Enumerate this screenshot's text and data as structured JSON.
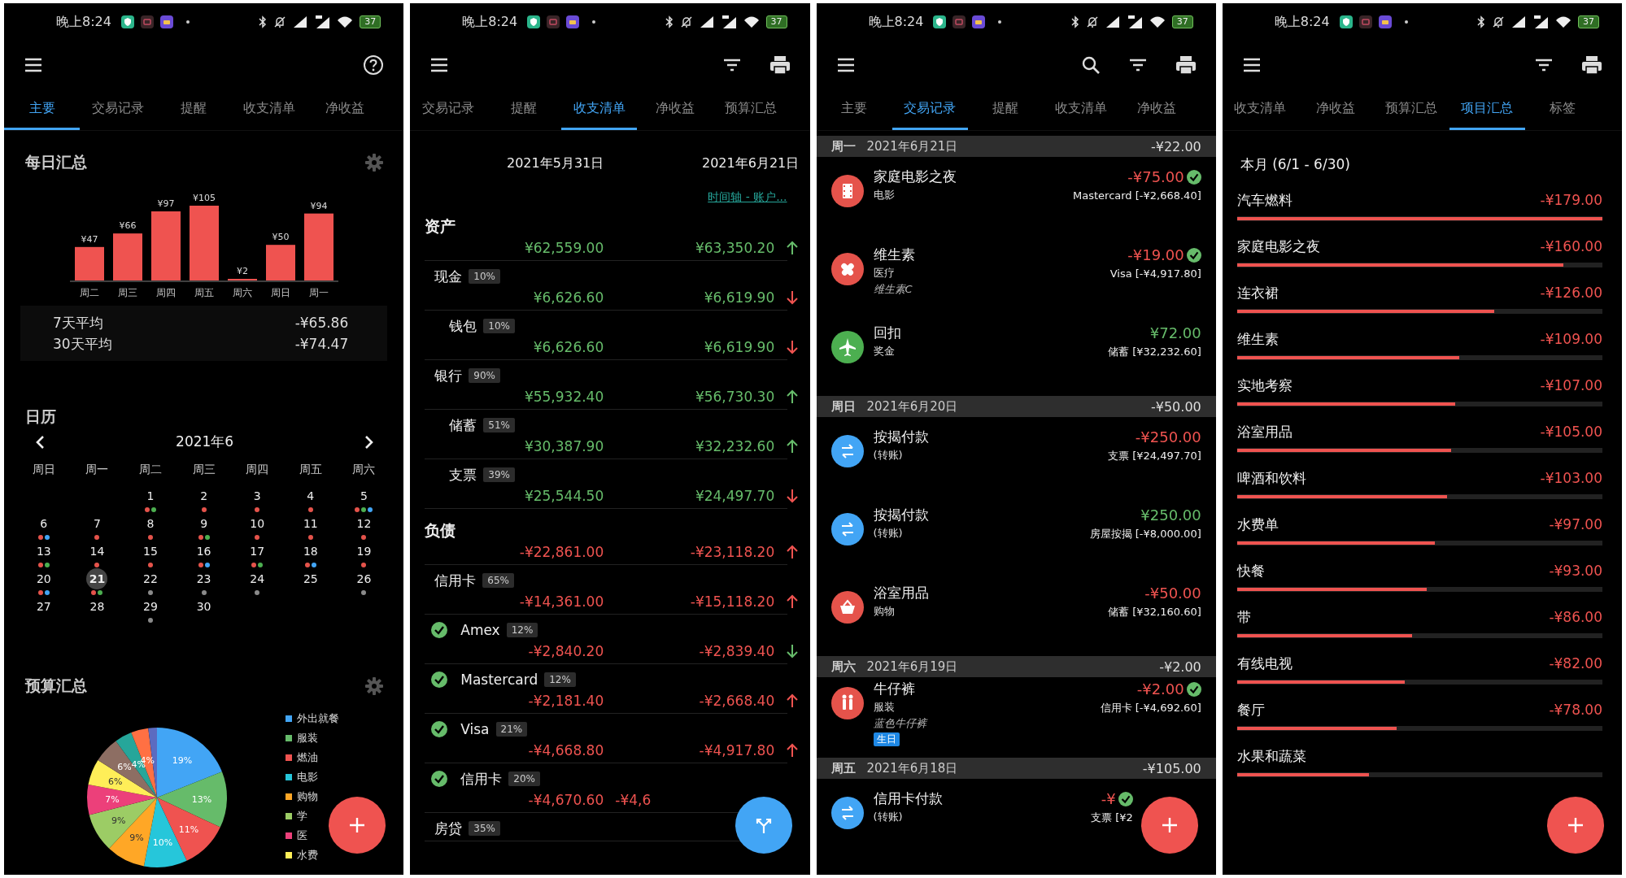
{
  "screens": [
    {
      "kind": "summary",
      "status": {
        "time": "晚上8:24",
        "battery": "37"
      },
      "actions": [
        {
          "kind": "help"
        }
      ],
      "tabs": [
        {
          "label": "主要",
          "selected": true
        },
        {
          "label": "交易记录",
          "selected": false
        },
        {
          "label": "提醒",
          "selected": false
        },
        {
          "label": "收支清单",
          "selected": false
        },
        {
          "label": "净收益",
          "selected": false
        }
      ],
      "daily": {
        "title": "每日汇总",
        "chart_data": {
          "type": "bar",
          "categories": [
            "周二",
            "周三",
            "周四",
            "周五",
            "周六",
            "周日",
            "周一"
          ],
          "values": [
            47,
            66,
            97,
            105,
            2,
            50,
            94
          ],
          "value_labels": [
            "¥47",
            "¥66",
            "¥97",
            "¥105",
            "¥2",
            "¥50",
            "¥94"
          ]
        },
        "averages": [
          {
            "label": "7天平均",
            "value": "-¥65.86"
          },
          {
            "label": "30天平均",
            "value": "-¥74.47"
          }
        ]
      },
      "calendar": {
        "title": "日历",
        "month": "2021年6",
        "weekdays": [
          "周日",
          "周一",
          "周二",
          "周三",
          "周四",
          "周五",
          "周六"
        ],
        "weeks": [
          [
            {
              "day": "1",
              "selected": false,
              "dots": [
                {
                  "color": "#e5534b"
                },
                {
                  "color": "#4caf50"
                }
              ]
            },
            {
              "day": "2",
              "selected": false,
              "dots": [
                {
                  "color": "#e5534b"
                }
              ]
            },
            {
              "day": "3",
              "selected": false,
              "dots": [
                {
                  "color": "#e5534b"
                }
              ]
            },
            {
              "day": "4",
              "selected": false,
              "dots": [
                {
                  "color": "#e5534b"
                }
              ]
            },
            {
              "day": "5",
              "selected": false,
              "dots": [
                {
                  "color": "#e5534b"
                },
                {
                  "color": "#4caf50"
                },
                {
                  "color": "#42a5f5"
                }
              ]
            }
          ],
          [
            {
              "day": "6",
              "selected": false,
              "dots": [
                {
                  "color": "#e5534b"
                },
                {
                  "color": "#42a5f5"
                }
              ]
            },
            {
              "day": "7",
              "selected": false,
              "dots": [
                {
                  "color": "#e5534b"
                }
              ]
            },
            {
              "day": "8",
              "selected": false,
              "dots": [
                {
                  "color": "#e5534b"
                }
              ]
            },
            {
              "day": "9",
              "selected": false,
              "dots": [
                {
                  "color": "#e5534b"
                },
                {
                  "color": "#4caf50"
                }
              ]
            },
            {
              "day": "10",
              "selected": false,
              "dots": [
                {
                  "color": "#e5534b"
                }
              ]
            },
            {
              "day": "11",
              "selected": false,
              "dots": [
                {
                  "color": "#e5534b"
                }
              ]
            },
            {
              "day": "12",
              "selected": false,
              "dots": [
                {
                  "color": "#e5534b"
                }
              ]
            }
          ],
          [
            {
              "day": "13",
              "selected": false,
              "dots": [
                {
                  "color": "#e5534b"
                },
                {
                  "color": "#4caf50"
                }
              ]
            },
            {
              "day": "14",
              "selected": false,
              "dots": [
                {
                  "color": "#e5534b"
                }
              ]
            },
            {
              "day": "15",
              "selected": false,
              "dots": [
                {
                  "color": "#e5534b"
                }
              ]
            },
            {
              "day": "16",
              "selected": false,
              "dots": [
                {
                  "color": "#e5534b"
                },
                {
                  "color": "#42a5f5"
                }
              ]
            },
            {
              "day": "17",
              "selected": false,
              "dots": [
                {
                  "color": "#e5534b"
                },
                {
                  "color": "#4caf50"
                }
              ]
            },
            {
              "day": "18",
              "selected": false,
              "dots": [
                {
                  "color": "#e5534b"
                },
                {
                  "color": "#42a5f5"
                }
              ]
            },
            {
              "day": "19",
              "selected": false,
              "dots": [
                {
                  "color": "#e5534b"
                }
              ]
            }
          ],
          [
            {
              "day": "20",
              "selected": false,
              "dots": [
                {
                  "color": "#e5534b"
                },
                {
                  "color": "#42a5f5"
                }
              ]
            },
            {
              "day": "21",
              "selected": true,
              "dots": [
                {
                  "color": "#e5534b"
                },
                {
                  "color": "#4caf50"
                }
              ]
            },
            {
              "day": "22",
              "selected": false,
              "dots": [
                {
                  "color": "#8a8a8a"
                }
              ]
            },
            {
              "day": "23",
              "selected": false,
              "dots": [
                {
                  "color": "#8a8a8a"
                }
              ]
            },
            {
              "day": "24",
              "selected": false,
              "dots": [
                {
                  "color": "#8a8a8a"
                }
              ]
            },
            {
              "day": "25",
              "selected": false
            },
            {
              "day": "26",
              "selected": false,
              "dots": [
                {
                  "color": "#8a8a8a"
                }
              ]
            }
          ],
          [
            {
              "day": "27",
              "selected": false
            },
            {
              "day": "28",
              "selected": false
            },
            {
              "day": "29",
              "selected": false,
              "dots": [
                {
                  "color": "#8a8a8a"
                }
              ]
            },
            {
              "day": "30",
              "selected": false
            }
          ]
        ]
      },
      "budget": {
        "title": "预算汇总",
        "chart_data": {
          "type": "pie",
          "values": [
            19,
            13,
            11,
            10,
            9,
            9,
            7,
            6,
            6,
            4,
            4,
            2
          ],
          "colors": [
            "#42a5f5",
            "#66bb6a",
            "#ef5350",
            "#26c6da",
            "#ffa726",
            "#9ccc65",
            "#ec407a",
            "#ffee58",
            "#8d6e63",
            "#26a69a",
            "#ff7043",
            "#5c6bc0"
          ],
          "value_labels": [
            "19%",
            "13%",
            "11%",
            "10%",
            "9%",
            "9%",
            "7%",
            "6%",
            "6%",
            "4%",
            "4%",
            null
          ]
        },
        "legend": [
          {
            "label": "外出就餐",
            "color": "#42a5f5"
          },
          {
            "label": "服装",
            "color": "#66bb6a"
          },
          {
            "label": "燃油",
            "color": "#ef5350"
          },
          {
            "label": "电影",
            "color": "#26c6da"
          },
          {
            "label": "购物",
            "color": "#ffa726"
          },
          {
            "label": "学",
            "color": "#9ccc65"
          },
          {
            "label": "医",
            "color": "#ec407a"
          },
          {
            "label": "水费",
            "color": "#ffee58"
          }
        ]
      },
      "fab": {
        "kind": "add"
      }
    },
    {
      "kind": "balance",
      "status": {
        "time": "晚上8:24",
        "battery": "37"
      },
      "actions": [
        {
          "kind": "filter"
        },
        {
          "kind": "print"
        }
      ],
      "tabs": [
        {
          "label": "交易记录",
          "selected": false
        },
        {
          "label": "提醒",
          "selected": false
        },
        {
          "label": "收支清单",
          "selected": true
        },
        {
          "label": "净收益",
          "selected": false
        },
        {
          "label": "预算汇总",
          "selected": false
        }
      ],
      "dates": [
        "2021年5月31日",
        "2021年6月21日"
      ],
      "link": "时间轴 - 账户...",
      "sections": [
        {
          "title": "资产",
          "kind": "asset",
          "start": "¥62,559.00",
          "end": "¥63,350.20",
          "rising": true,
          "accounts": [
            {
              "name": "现金",
              "share": "10%",
              "reconciled": false,
              "start": "¥6,626.60",
              "end": "¥6,619.90",
              "rising": false,
              "children": [
                {
                  "name": "钱包",
                  "share": "10%",
                  "reconciled": false,
                  "start": "¥6,626.60",
                  "end": "¥6,619.90",
                  "rising": false
                }
              ]
            },
            {
              "name": "银行",
              "share": "90%",
              "reconciled": false,
              "start": "¥55,932.40",
              "end": "¥56,730.30",
              "rising": true,
              "children": [
                {
                  "name": "储蓄",
                  "share": "51%",
                  "reconciled": false,
                  "start": "¥30,387.90",
                  "end": "¥32,232.60",
                  "rising": true
                },
                {
                  "name": "支票",
                  "share": "39%",
                  "reconciled": false,
                  "start": "¥25,544.50",
                  "end": "¥24,497.70",
                  "rising": false
                }
              ]
            }
          ]
        },
        {
          "title": "负债",
          "kind": "liability",
          "start": "-¥22,861.00",
          "end": "-¥23,118.20",
          "rising": true,
          "accounts": [
            {
              "name": "信用卡",
              "share": "65%",
              "reconciled": false,
              "start": "-¥14,361.00",
              "end": "-¥15,118.20",
              "rising": true,
              "children": [
                {
                  "name": "Amex",
                  "share": "12%",
                  "reconciled": true,
                  "start": "-¥2,840.20",
                  "end": "-¥2,839.40",
                  "rising": false
                },
                {
                  "name": "Mastercard",
                  "share": "12%",
                  "reconciled": true,
                  "start": "-¥2,181.40",
                  "end": "-¥2,668.40",
                  "rising": true
                },
                {
                  "name": "Visa",
                  "share": "21%",
                  "reconciled": true,
                  "start": "-¥4,668.80",
                  "end": "-¥4,917.80",
                  "rising": true
                },
                {
                  "name": "信用卡",
                  "share": "20%",
                  "reconciled": true,
                  "start": "-¥4,670.60",
                  "end": "-¥4,6"
                }
              ]
            },
            {
              "name": "房贷",
              "share": "35%",
              "reconciled": false
            }
          ]
        }
      ],
      "fab": {
        "kind": "split"
      }
    },
    {
      "kind": "transactions",
      "status": {
        "time": "晚上8:24",
        "battery": "37"
      },
      "actions": [
        {
          "kind": "search"
        },
        {
          "kind": "filter"
        },
        {
          "kind": "print"
        }
      ],
      "tabs": [
        {
          "label": "主要",
          "selected": false
        },
        {
          "label": "交易记录",
          "selected": true
        },
        {
          "label": "提醒",
          "selected": false
        },
        {
          "label": "收支清单",
          "selected": false
        },
        {
          "label": "净收益",
          "selected": false
        }
      ],
      "groups": [
        {
          "weekday": "周一",
          "date": "2021年6月21日",
          "total": "-¥22.00",
          "items": [
            {
              "kind": "film",
              "color": "#e5534b",
              "title": "家庭电影之夜",
              "category": "电影",
              "amount": "-¥75.00",
              "income": false,
              "cleared": true,
              "account": "Mastercard [-¥2,668.40]"
            },
            {
              "kind": "bandage",
              "color": "#e5534b",
              "title": "维生素",
              "category": "医疗",
              "note": "维生素C",
              "amount": "-¥19.00",
              "income": false,
              "cleared": true,
              "account": "Visa [-¥4,917.80]"
            },
            {
              "kind": "plane",
              "color": "#4caf50",
              "title": "回扣",
              "category": "奖金",
              "amount": "¥72.00",
              "income": true,
              "cleared": false,
              "account": "储蓄 [¥32,232.60]"
            }
          ]
        },
        {
          "weekday": "周日",
          "date": "2021年6月20日",
          "total": "-¥50.00",
          "items": [
            {
              "kind": "transfer",
              "color": "#42a5f5",
              "title": "按揭付款",
              "category": "(转账)",
              "amount": "-¥250.00",
              "income": false,
              "cleared": false,
              "account": "支票 [¥24,497.70]"
            },
            {
              "kind": "transfer",
              "color": "#42a5f5",
              "title": "按揭付款",
              "category": "(转账)",
              "amount": "¥250.00",
              "income": true,
              "cleared": false,
              "account": "房屋按揭 [-¥8,000.00]"
            },
            {
              "kind": "basket",
              "color": "#e5534b",
              "title": "浴室用品",
              "category": "购物",
              "amount": "-¥50.00",
              "income": false,
              "cleared": false,
              "account": "储蓄 [¥32,160.60]"
            }
          ]
        },
        {
          "weekday": "周六",
          "date": "2021年6月19日",
          "total": "-¥2.00",
          "items": [
            {
              "kind": "people",
              "color": "#e5534b",
              "title": "牛仔裤",
              "category": "服装",
              "note": "蓝色牛仔裤",
              "tag": "生日",
              "amount": "-¥2.00",
              "income": false,
              "cleared": true,
              "account": "信用卡 [-¥4,692.60]"
            }
          ]
        },
        {
          "weekday": "周五",
          "date": "2021年6月18日",
          "total": "-¥105.00",
          "items": [
            {
              "kind": "transfer",
              "color": "#42a5f5",
              "title": "信用卡付款",
              "category": "(转账)",
              "amount": "-¥",
              "income": false,
              "cleared": true,
              "account": "支票 [¥2"
            }
          ]
        }
      ],
      "fab": {
        "kind": "add"
      }
    },
    {
      "kind": "items",
      "status": {
        "time": "晚上8:24",
        "battery": "37"
      },
      "actions": [
        {
          "kind": "filter"
        },
        {
          "kind": "print"
        }
      ],
      "tabs": [
        {
          "label": "收支清单",
          "selected": false
        },
        {
          "label": "净收益",
          "selected": false
        },
        {
          "label": "预算汇总",
          "selected": false
        },
        {
          "label": "项目汇总",
          "selected": true
        },
        {
          "label": "标签",
          "selected": false
        }
      ],
      "period": "本月 (6/1 - 6/30)",
      "items": [
        {
          "name": "汽车燃料",
          "amount": "-¥179.00",
          "level": 1
        },
        {
          "name": "家庭电影之夜",
          "amount": "-¥160.00",
          "level": 0.894
        },
        {
          "name": "连衣裙",
          "amount": "-¥126.00",
          "level": 0.704
        },
        {
          "name": "维生素",
          "amount": "-¥109.00",
          "level": 0.609
        },
        {
          "name": "实地考察",
          "amount": "-¥107.00",
          "level": 0.598
        },
        {
          "name": "浴室用品",
          "amount": "-¥105.00",
          "level": 0.587
        },
        {
          "name": "啤酒和饮料",
          "amount": "-¥103.00",
          "level": 0.575
        },
        {
          "name": "水费单",
          "amount": "-¥97.00",
          "level": 0.542
        },
        {
          "name": "快餐",
          "amount": "-¥93.00",
          "level": 0.52
        },
        {
          "name": "带",
          "amount": "-¥86.00",
          "level": 0.48
        },
        {
          "name": "有线电视",
          "amount": "-¥82.00",
          "level": 0.458
        },
        {
          "name": "餐厅",
          "amount": "-¥78.00",
          "level": 0.436
        },
        {
          "name": "水果和蔬菜",
          "level": 0.362
        }
      ],
      "fab": {
        "kind": "add"
      }
    }
  ]
}
